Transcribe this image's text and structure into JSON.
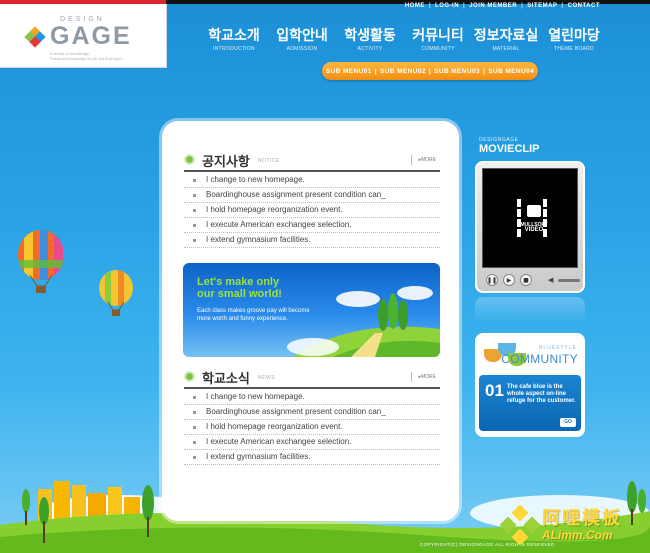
{
  "logo": {
    "small": "DESIGN",
    "name": "GAGE",
    "tagline": "Everlast of knowledge\nPractical Knowledge for all world all ages"
  },
  "topnav": [
    "HOME",
    "LOG-IN",
    "JOIN MEMBER",
    "SITEMAP",
    "CONTACT"
  ],
  "mainnav": [
    {
      "ko": "학교소개",
      "en": "INTRODUCTION"
    },
    {
      "ko": "입학안내",
      "en": "ADMISSION"
    },
    {
      "ko": "학생활동",
      "en": "ACTIVITY"
    },
    {
      "ko": "커뮤니티",
      "en": "COMMUNITY"
    },
    {
      "ko": "정보자료실",
      "en": "MATERIAL"
    },
    {
      "ko": "열린마당",
      "en": "THEME BOARD"
    }
  ],
  "submenu": [
    "SUB MENU01",
    "SUB MENU02",
    "SUB MENU03",
    "SUB MENU04"
  ],
  "notice": {
    "title": "공지사항",
    "tag": "NOTICE",
    "more": "MORE",
    "items": [
      "I change to new homepage.",
      "Boardinghouse assignment present condition can_",
      "I hold homepage reorganization event.",
      "I execute American exchangee selection.",
      "I extend gymnasium facilities."
    ]
  },
  "banner": {
    "line1": "Let's make only",
    "line2": "our small world!",
    "sub1": "Each class makes groove pay will become",
    "sub2": "more worth and funny experience."
  },
  "news": {
    "title": "학교소식",
    "tag": "NEWS",
    "more": "MORE",
    "items": [
      "I change to new homepage.",
      "Boardinghouse assignment present condition can_",
      "I hold homepage reorganization event.",
      "I execute American exchangee selection.",
      "I extend gymnasium facilities."
    ]
  },
  "movie": {
    "small": "DESIGNGAGE",
    "title": "MOVIECLIP",
    "screen_brand": "MULLSOFT",
    "screen_label": "VIDEO"
  },
  "community": {
    "small": "BLUESTYLE",
    "title": "COMMUNITY",
    "number": "01",
    "text": "The cafe blue is the whole aspect on-line refuge for the customer.",
    "go": "GO"
  },
  "footer": {
    "copyright": "COPYRIGHT(C) DESIGNGAGE ALL RIGHTS RESERVED"
  },
  "watermark": {
    "ko": "阿哩模板",
    "url": "ALimm.Com"
  },
  "colors": {
    "sky": "#2aa3e6",
    "accent_orange": "#f5a12a",
    "brand_red": "#d8262d",
    "grass": "#7fc241",
    "text": "#444444"
  }
}
